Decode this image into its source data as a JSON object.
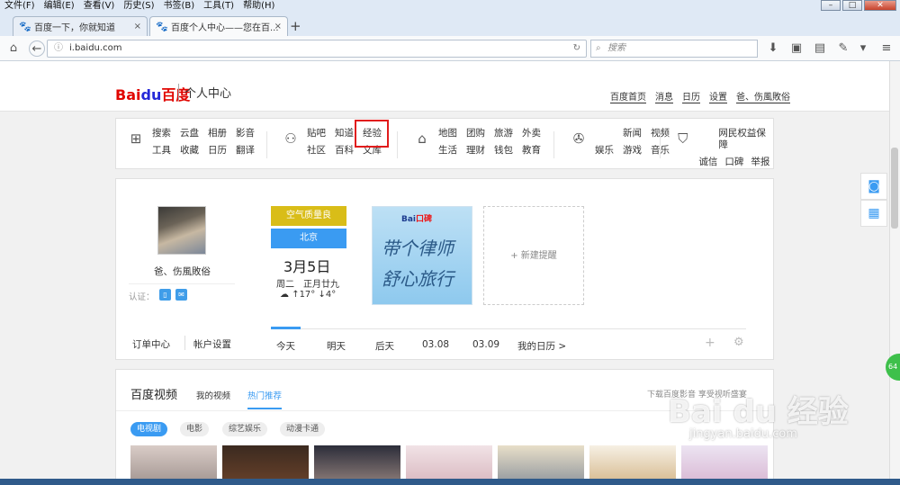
{
  "menubar": [
    "文件(F)",
    "编辑(E)",
    "查看(V)",
    "历史(S)",
    "书签(B)",
    "工具(T)",
    "帮助(H)"
  ],
  "tabs": [
    {
      "label": "百度一下，你就知道"
    },
    {
      "label": "百度个人中心——您在百..."
    }
  ],
  "url": "i.baidu.com",
  "search_placeholder": "搜索",
  "header": {
    "logo_bai": "Bai",
    "logo_du": "du",
    "logo_cn": "百度",
    "subtitle": "个人中心",
    "links": [
      "百度首页",
      "消息",
      "日历",
      "设置",
      "爸、伤風敗俗"
    ]
  },
  "services": {
    "tools": [
      "搜索",
      "云盘",
      "相册",
      "影音",
      "工具",
      "收藏",
      "日历",
      "翻译"
    ],
    "community": [
      "贴吧",
      "知道",
      "经验",
      "社区",
      "百科",
      "文库"
    ],
    "life": [
      "地图",
      "团购",
      "旅游",
      "外卖",
      "生活",
      "理财",
      "钱包",
      "教育"
    ],
    "entertainment": [
      "新闻",
      "视频",
      "娱乐",
      "游戏",
      "音乐"
    ],
    "trust": [
      "网民权益保障",
      "诚信",
      "口碑",
      "举报"
    ]
  },
  "profile": {
    "username": "爸、伤風敗俗",
    "auth_label": "认证：",
    "links": [
      "订单中心",
      "帐户设置"
    ]
  },
  "calendar": {
    "air_quality": "空气质量良",
    "city": "北京",
    "date": "3月5日",
    "lunar": "周二　正月廿九",
    "temp": "↑17° ↓4°",
    "tabs": [
      "今天",
      "明天",
      "后天",
      "03.08",
      "03.09",
      "我的日历 >"
    ]
  },
  "banner": {
    "brand": "Bai",
    "brand_red": "口碑",
    "line1": "带个律师",
    "line2": "舒心旅行"
  },
  "new_reminder": "+ 新建提醒",
  "video": {
    "title": "百度视频",
    "tabs": [
      "我的视频",
      "热门推荐"
    ],
    "right": "下载百度影音 享受视听盛宴",
    "pills": [
      "电视剧",
      "电影",
      "综艺娱乐",
      "动漫卡通"
    ]
  },
  "watermark": "Bai du 经验",
  "watermark_url": "jingyan.baidu.com",
  "badge": "64"
}
